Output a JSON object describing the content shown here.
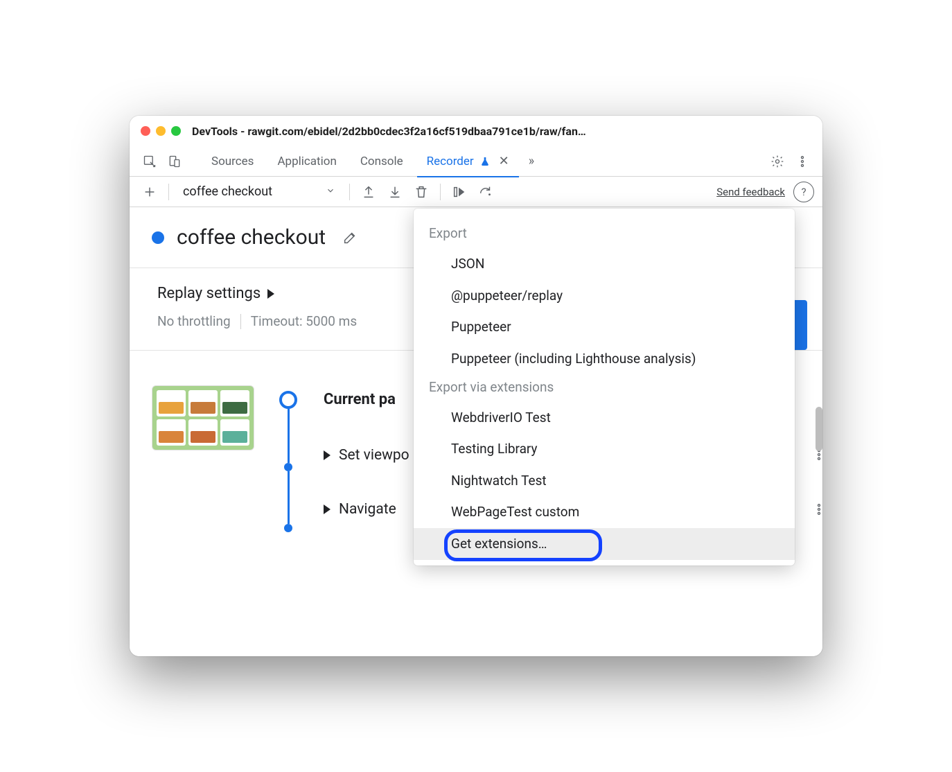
{
  "window": {
    "title": "DevTools - rawgit.com/ebidel/2d2bb0cdec3f2a16cf519dbaa791ce1b/raw/fan…"
  },
  "tabs": {
    "items": [
      "Sources",
      "Application",
      "Console",
      "Recorder"
    ],
    "active_index": 3
  },
  "toolbar": {
    "recording_name": "coffee checkout",
    "feedback_label": "Send feedback"
  },
  "title_section": {
    "name": "coffee checkout"
  },
  "replay": {
    "heading": "Replay settings",
    "throttling": "No throttling",
    "timeout": "Timeout: 5000 ms"
  },
  "steps": {
    "current_label": "Current pa",
    "items": [
      "Set viewpo",
      "Navigate"
    ]
  },
  "export_menu": {
    "section1_label": "Export",
    "items1": [
      "JSON",
      "@puppeteer/replay",
      "Puppeteer",
      "Puppeteer (including Lighthouse analysis)"
    ],
    "section2_label": "Export via extensions",
    "items2": [
      "WebdriverIO Test",
      "Testing Library",
      "Nightwatch Test",
      "WebPageTest custom",
      "Get extensions…"
    ]
  }
}
